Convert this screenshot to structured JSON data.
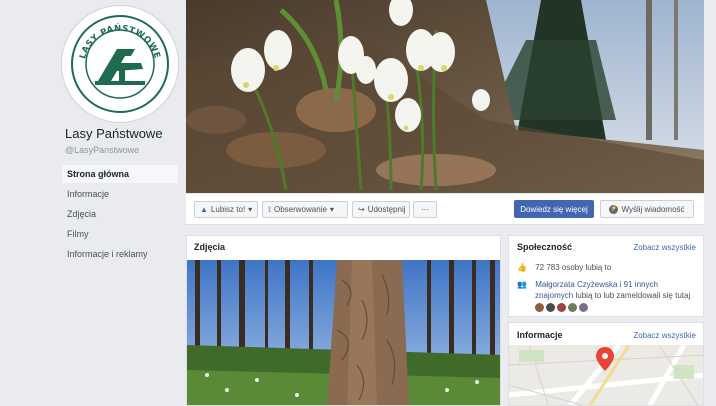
{
  "page": {
    "name": "Lasy Państwowe",
    "handle": "@LasyPanstwowe",
    "logo_text": "LASY PAŃSTWOWE"
  },
  "nav": [
    {
      "label": "Strona główna",
      "active": true
    },
    {
      "label": "Informacje"
    },
    {
      "label": "Zdjęcia"
    },
    {
      "label": "Filmy"
    },
    {
      "label": "Informacje i reklamy"
    }
  ],
  "actions": {
    "like": "Lubisz to!",
    "follow": "Obserwowanie",
    "share": "Udostępnij",
    "more": "···",
    "learn_more": "Dowiedz się więcej",
    "send_message": "Wyślij wiadomość"
  },
  "photos": {
    "title": "Zdjęcia"
  },
  "community": {
    "title": "Społeczność",
    "see_all": "Zobacz wszystkie",
    "likes": "72 783 osoby lubią to",
    "friends_names": "Małgorzata Czyżewska i 91 innych",
    "friends_line2_link": "znajomych",
    "friends_line2_rest": "lubią to lub zameldowali się tutaj"
  },
  "info": {
    "title": "Informacje",
    "see_all": "Zobacz wszystkie"
  },
  "colors": {
    "accent": "#4267b2",
    "background": "#e9ebee",
    "link": "#365899"
  }
}
